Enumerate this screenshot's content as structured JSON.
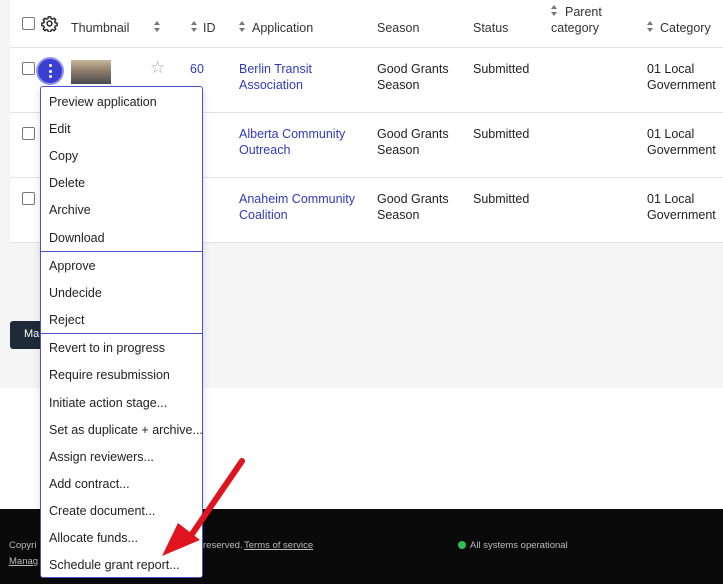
{
  "table": {
    "columns": {
      "thumbnail": "Thumbnail",
      "id": "ID",
      "application": "Application",
      "season": "Season",
      "status": "Status",
      "parent_category_1": "Parent",
      "parent_category_2": "category",
      "category": "Category"
    },
    "rows": [
      {
        "id": "60",
        "application_1": "Berlin Transit",
        "application_2": "Association",
        "season_1": "Good Grants",
        "season_2": "Season",
        "status": "Submitted",
        "category_1": "01 Local",
        "category_2": "Government"
      },
      {
        "id": "",
        "application_1": "Alberta Community",
        "application_2": "Outreach",
        "season_1": "Good Grants",
        "season_2": "Season",
        "status": "Submitted",
        "category_1": "01 Local",
        "category_2": "Government"
      },
      {
        "id": "",
        "application_1": "Anaheim Community",
        "application_2": "Coalition",
        "season_1": "Good Grants",
        "season_2": "Season",
        "status": "Submitted",
        "category_1": "01 Local",
        "category_2": "Government"
      }
    ]
  },
  "manage_button": {
    "label": "Ma"
  },
  "context_menu": {
    "group1": [
      "Preview application",
      "Edit",
      "Copy",
      "Delete",
      "Archive",
      "Download"
    ],
    "group2": [
      "Approve",
      "Undecide",
      "Reject"
    ],
    "group3": [
      "Revert to in progress",
      "Require resubmission",
      "Initiate action stage...",
      "Set as duplicate + archive...",
      "Assign reviewers...",
      "Add contract...",
      "Create document...",
      "Allocate funds...",
      "Schedule grant report..."
    ]
  },
  "footer": {
    "copyright": "Copyri",
    "reserved": "reserved.",
    "terms": "Terms of service",
    "manage": "Manag",
    "status": "All systems operational"
  },
  "colors": {
    "accent": "#3a3fd0",
    "link": "#2f3bbd",
    "status_ok": "#2fbf52",
    "annotation": "#e0141e"
  },
  "icons": [
    "settings-gear-icon",
    "sort-icon",
    "kebab-icon",
    "star-icon",
    "red-arrow-annotation"
  ]
}
